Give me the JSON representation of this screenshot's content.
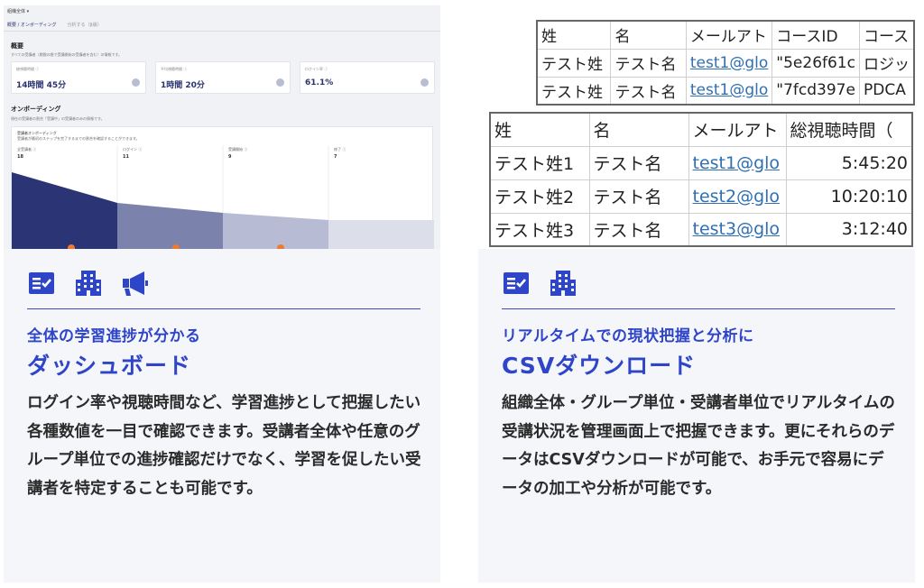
{
  "left": {
    "dashboard": {
      "topbar": "組織全体 ▾",
      "tabs": [
        "概要 / オンボーディング",
        "分析する（β版）"
      ],
      "overview_title": "概要",
      "overview_sub": "すべての受講者（期間の間で受講開始の受講者を含む）の情報です。",
      "kpis": [
        {
          "label": "総視聴時間 ⓘ",
          "value": "14時間 45分"
        },
        {
          "label": "平均視聴時間 ⓘ",
          "value": "1時間 20分"
        },
        {
          "label": "ログイン率 ⓘ",
          "value": "61.1%"
        }
      ],
      "onboarding_title": "オンボーディング",
      "onboarding_sub": "現在の受講者の割合「受講中」の受講者のみの情報です。",
      "funnel_title": "受講者オンボーディング",
      "funnel_sub": "受講者が最初のステップを完了するまでの割合を確認することができます。",
      "funnel_stages": [
        {
          "label": "全受講者 ⓘ",
          "count": "18"
        },
        {
          "label": "ログイン ⓘ",
          "count": "11"
        },
        {
          "label": "受講開始 ⓘ",
          "count": "9"
        },
        {
          "label": "修了 ⓘ",
          "count": "7"
        }
      ],
      "colors": {
        "stage1": "#2b3474",
        "stage2": "#7b82ac",
        "stage3": "#b7bbd3",
        "stage4": "#dcdfea"
      }
    },
    "icons": [
      "checklist-icon",
      "building-icon",
      "megaphone-icon"
    ],
    "subtitle": "全体の学習進捗が分かる",
    "title": "ダッシュボード",
    "body": "ログイン率や視聴時間など、学習進捗として把握したい各種数値を一目で確認できます。受講者全体や任意のグループ単位での進捗確認だけでなく、学習を促したい受講者を特定することも可能です。"
  },
  "right": {
    "csv_back": {
      "headers": [
        "姓",
        "名",
        "メールアト",
        "コースID",
        "コース"
      ],
      "rows": [
        [
          "テスト姓",
          "テスト名",
          "test1@glo",
          "\"5e26f61c",
          "ロジッ"
        ],
        [
          "テスト姓",
          "テスト名",
          "test1@glo",
          "\"7fcd397e",
          "PDCA"
        ]
      ]
    },
    "csv_front": {
      "headers": [
        "姓",
        "名",
        "メールアト",
        "総視聴時間（"
      ],
      "rows": [
        [
          "テスト姓1",
          "テスト名",
          "test1@glo",
          "5:45:20"
        ],
        [
          "テスト姓2",
          "テスト名",
          "test2@glo",
          "10:20:10"
        ],
        [
          "テスト姓3",
          "テスト名",
          "test3@glo",
          "3:12:40"
        ]
      ]
    },
    "icons": [
      "checklist-icon",
      "building-icon"
    ],
    "subtitle": "リアルタイムでの現状把握と分析に",
    "title": "CSVダウンロード",
    "body": "組織全体・グループ単位・受講者単位でリアルタイムの受講状況を管理画面上で把握できます。更にそれらのデータはCSVダウンロードが可能で、お手元で容易にデータの加工や分析が可能です。"
  },
  "accent": "#2f45c8"
}
